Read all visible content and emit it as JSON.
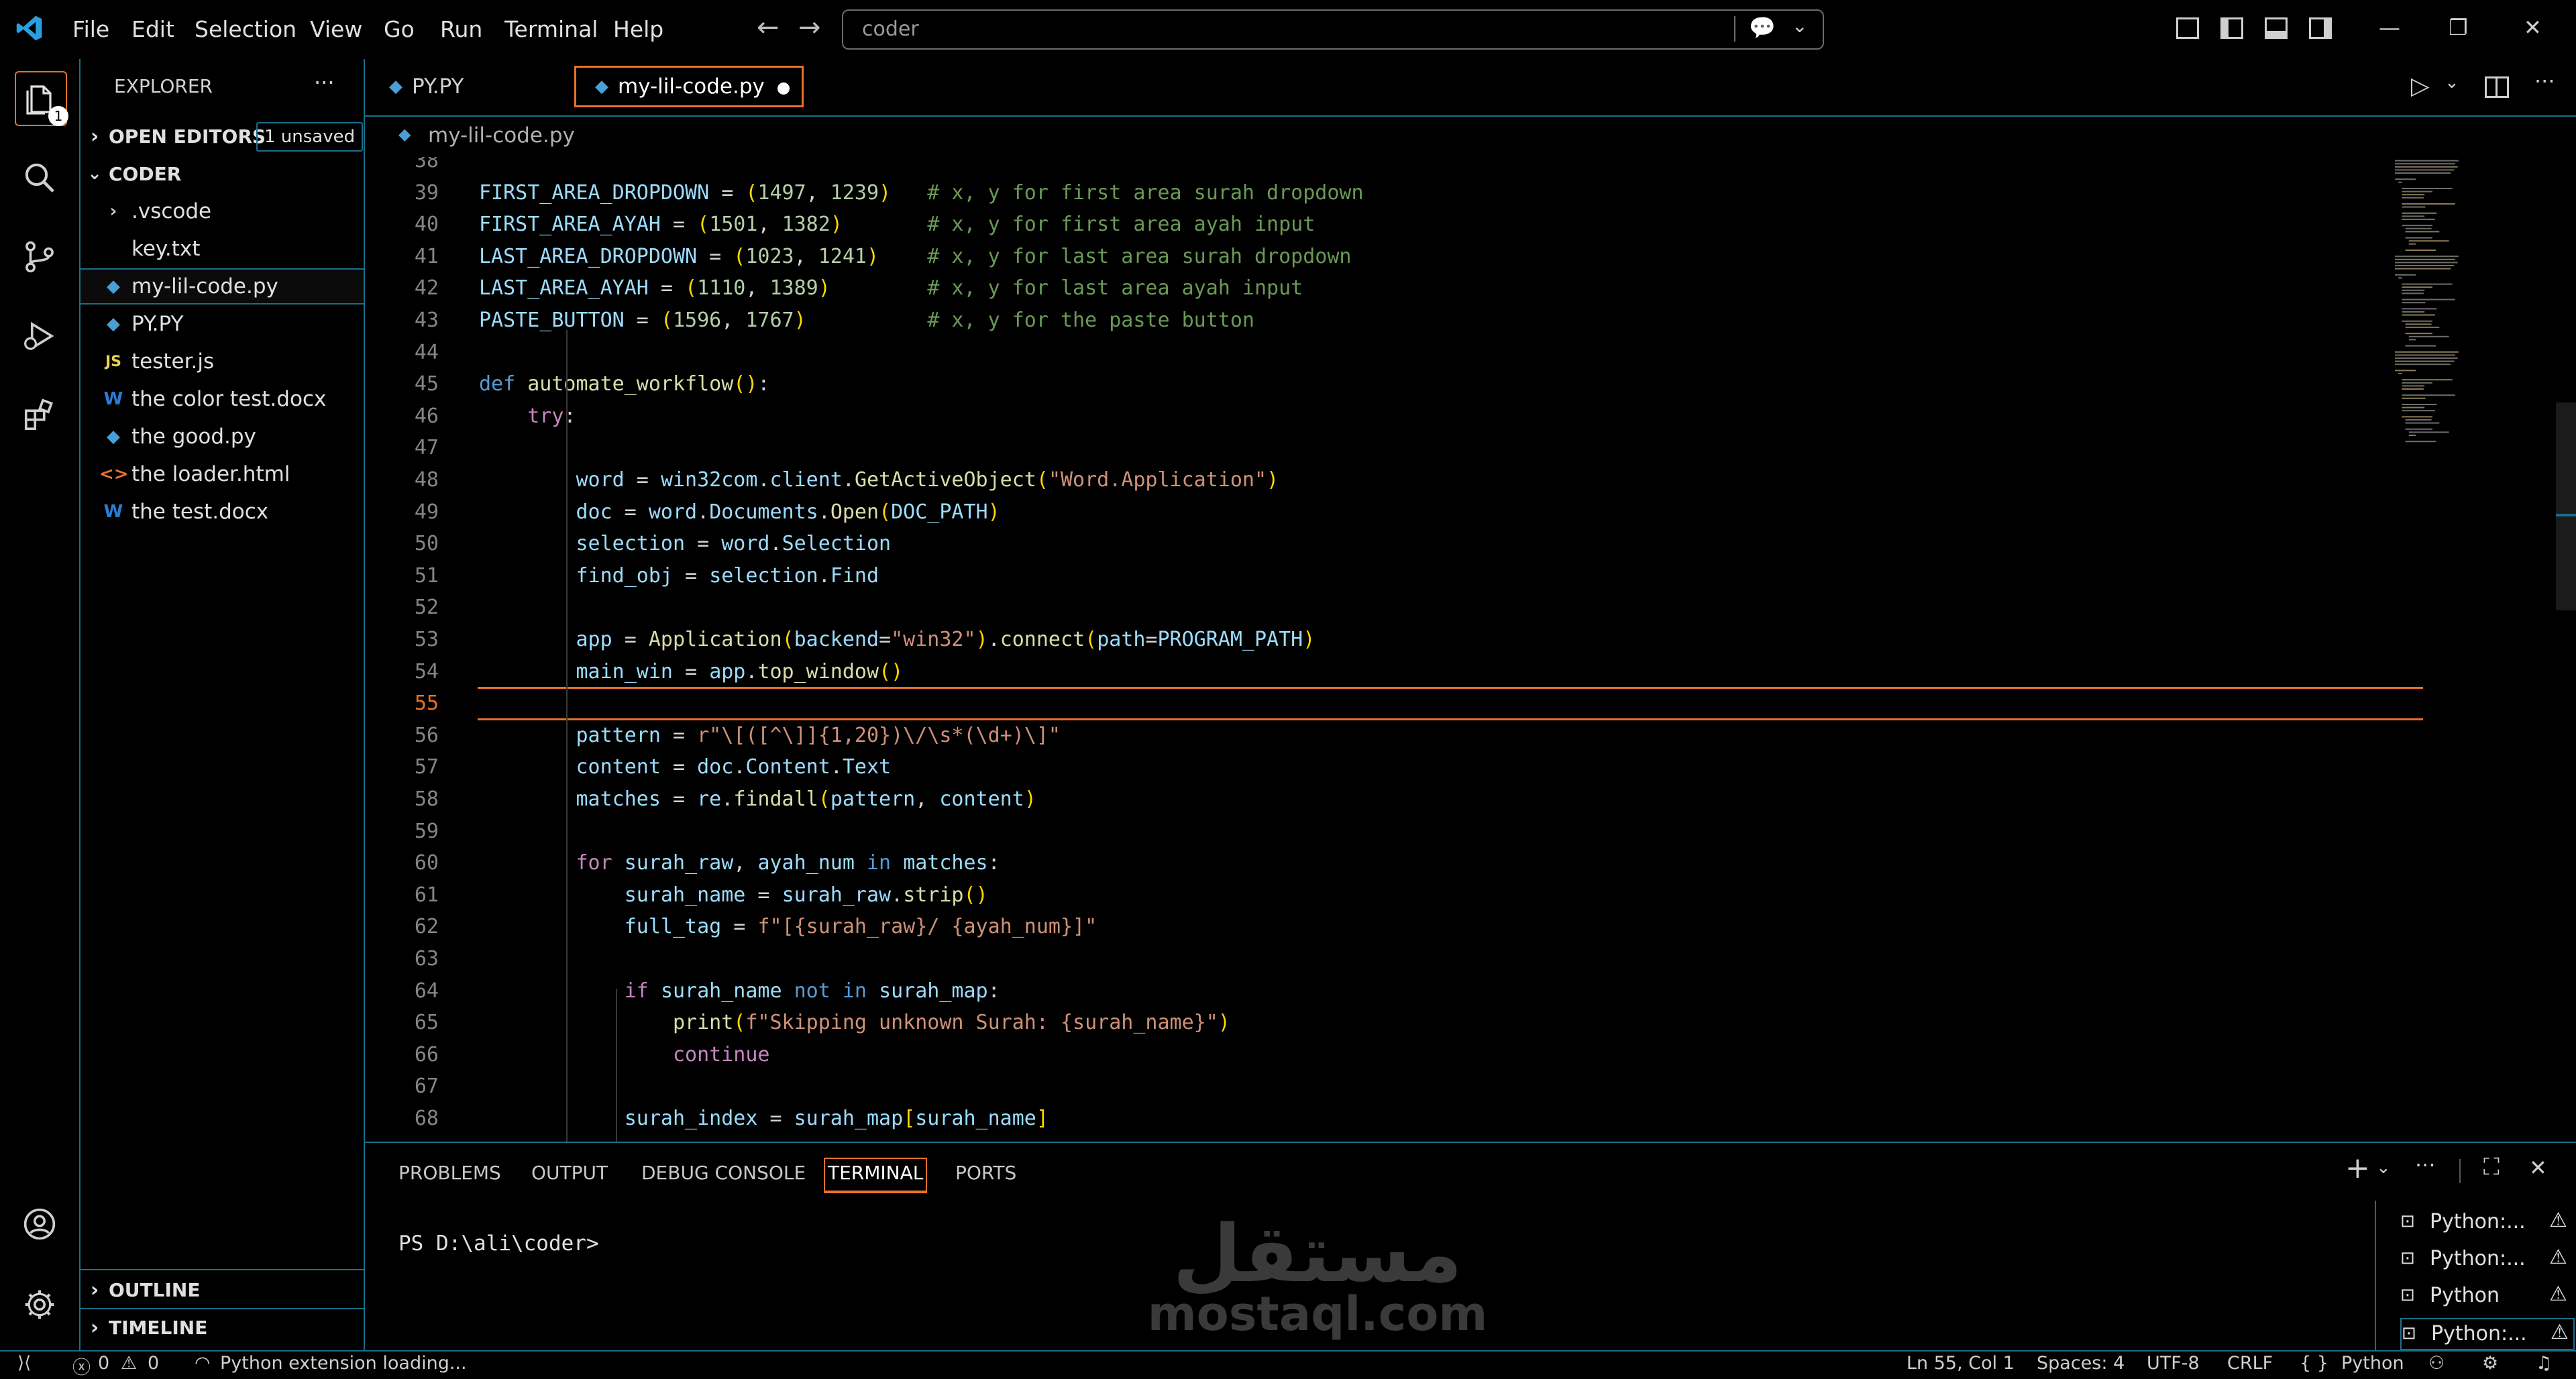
{
  "menu": [
    "File",
    "Edit",
    "Selection",
    "View",
    "Go",
    "Run",
    "Terminal",
    "Help"
  ],
  "search": {
    "value": "coder"
  },
  "activity": {
    "badge": "1"
  },
  "explorer": {
    "title": "EXPLORER",
    "open_editors": "OPEN EDITORS",
    "unsaved": "1 unsaved",
    "folder": "CODER",
    "items": [
      {
        "label": ".vscode",
        "icon": "chevron-right-icon",
        "glyph": "›"
      },
      {
        "label": "key.txt",
        "icon": "text-file-icon",
        "glyph": ""
      },
      {
        "label": "my-lil-code.py",
        "icon": "python-icon",
        "glyph": "py"
      },
      {
        "label": "PY.PY",
        "icon": "python-icon",
        "glyph": "py"
      },
      {
        "label": "tester.js",
        "icon": "javascript-icon",
        "glyph": "JS"
      },
      {
        "label": "the color test.docx",
        "icon": "word-icon",
        "glyph": "W"
      },
      {
        "label": "the good.py",
        "icon": "python-icon",
        "glyph": "py"
      },
      {
        "label": "the loader.html",
        "icon": "html-icon",
        "glyph": "<>"
      },
      {
        "label": "the test.docx",
        "icon": "word-icon",
        "glyph": "W"
      }
    ],
    "outline": "OUTLINE",
    "timeline": "TIMELINE"
  },
  "tabs": [
    {
      "label": "PY.PY"
    },
    {
      "label": "my-lil-code.py"
    }
  ],
  "breadcrumb": "my-lil-code.py",
  "code_lines": [
    {
      "n": "38",
      "code": ""
    },
    {
      "n": "39",
      "code": "FIRST_AREA_DROPDOWN = (1497, 1239)   # x, y for first area surah dropdown"
    },
    {
      "n": "40",
      "code": "FIRST_AREA_AYAH = (1501, 1382)       # x, y for first area ayah input"
    },
    {
      "n": "41",
      "code": "LAST_AREA_DROPDOWN = (1023, 1241)    # x, y for last area surah dropdown"
    },
    {
      "n": "42",
      "code": "LAST_AREA_AYAH = (1110, 1389)        # x, y for last area ayah input"
    },
    {
      "n": "43",
      "code": "PASTE_BUTTON = (1596, 1767)          # x, y for the paste button"
    },
    {
      "n": "44",
      "code": ""
    },
    {
      "n": "45",
      "code": "def automate_workflow():"
    },
    {
      "n": "46",
      "code": "    try:"
    },
    {
      "n": "47",
      "code": ""
    },
    {
      "n": "48",
      "code": "        word = win32com.client.GetActiveObject(\"Word.Application\")"
    },
    {
      "n": "49",
      "code": "        doc = word.Documents.Open(DOC_PATH)"
    },
    {
      "n": "50",
      "code": "        selection = word.Selection"
    },
    {
      "n": "51",
      "code": "        find_obj = selection.Find"
    },
    {
      "n": "52",
      "code": ""
    },
    {
      "n": "53",
      "code": "        app = Application(backend=\"win32\").connect(path=PROGRAM_PATH)"
    },
    {
      "n": "54",
      "code": "        main_win = app.top_window()"
    },
    {
      "n": "55",
      "code": ""
    },
    {
      "n": "56",
      "code": "        pattern = r\"\\[([^\\]]{1,20})\\/\\s*(\\d+)\\]\""
    },
    {
      "n": "57",
      "code": "        content = doc.Content.Text"
    },
    {
      "n": "58",
      "code": "        matches = re.findall(pattern, content)"
    },
    {
      "n": "59",
      "code": ""
    },
    {
      "n": "60",
      "code": "        for surah_raw, ayah_num in matches:"
    },
    {
      "n": "61",
      "code": "            surah_name = surah_raw.strip()"
    },
    {
      "n": "62",
      "code": "            full_tag = f\"[{surah_raw}/ {ayah_num}]\""
    },
    {
      "n": "63",
      "code": ""
    },
    {
      "n": "64",
      "code": "            if surah_name not in surah_map:"
    },
    {
      "n": "65",
      "code": "                print(f\"Skipping unknown Surah: {surah_name}\")"
    },
    {
      "n": "66",
      "code": "                continue"
    },
    {
      "n": "67",
      "code": ""
    },
    {
      "n": "68",
      "code": "            surah_index = surah_map[surah_name]"
    }
  ],
  "panel": {
    "tabs": [
      "PROBLEMS",
      "OUTPUT",
      "DEBUG CONSOLE",
      "TERMINAL",
      "PORTS"
    ],
    "active_tab": "TERMINAL",
    "prompt": "PS D:\\ali\\coder>",
    "terminals": [
      "Python:...",
      "Python:...",
      "Python",
      "Python:..."
    ]
  },
  "watermark": {
    "arabic": "مستقل",
    "latin": "mostaql.com"
  },
  "status": {
    "errors": "0",
    "warnings": "0",
    "message": "Python extension loading...",
    "position": "Ln 55, Col 1",
    "spaces": "Spaces: 4",
    "encoding": "UTF-8",
    "eol": "CRLF",
    "language": "Python"
  },
  "colors": {
    "accent": "#1a6e8a",
    "active_tab_border": "#e8702a",
    "current_line": "#e8702a"
  }
}
